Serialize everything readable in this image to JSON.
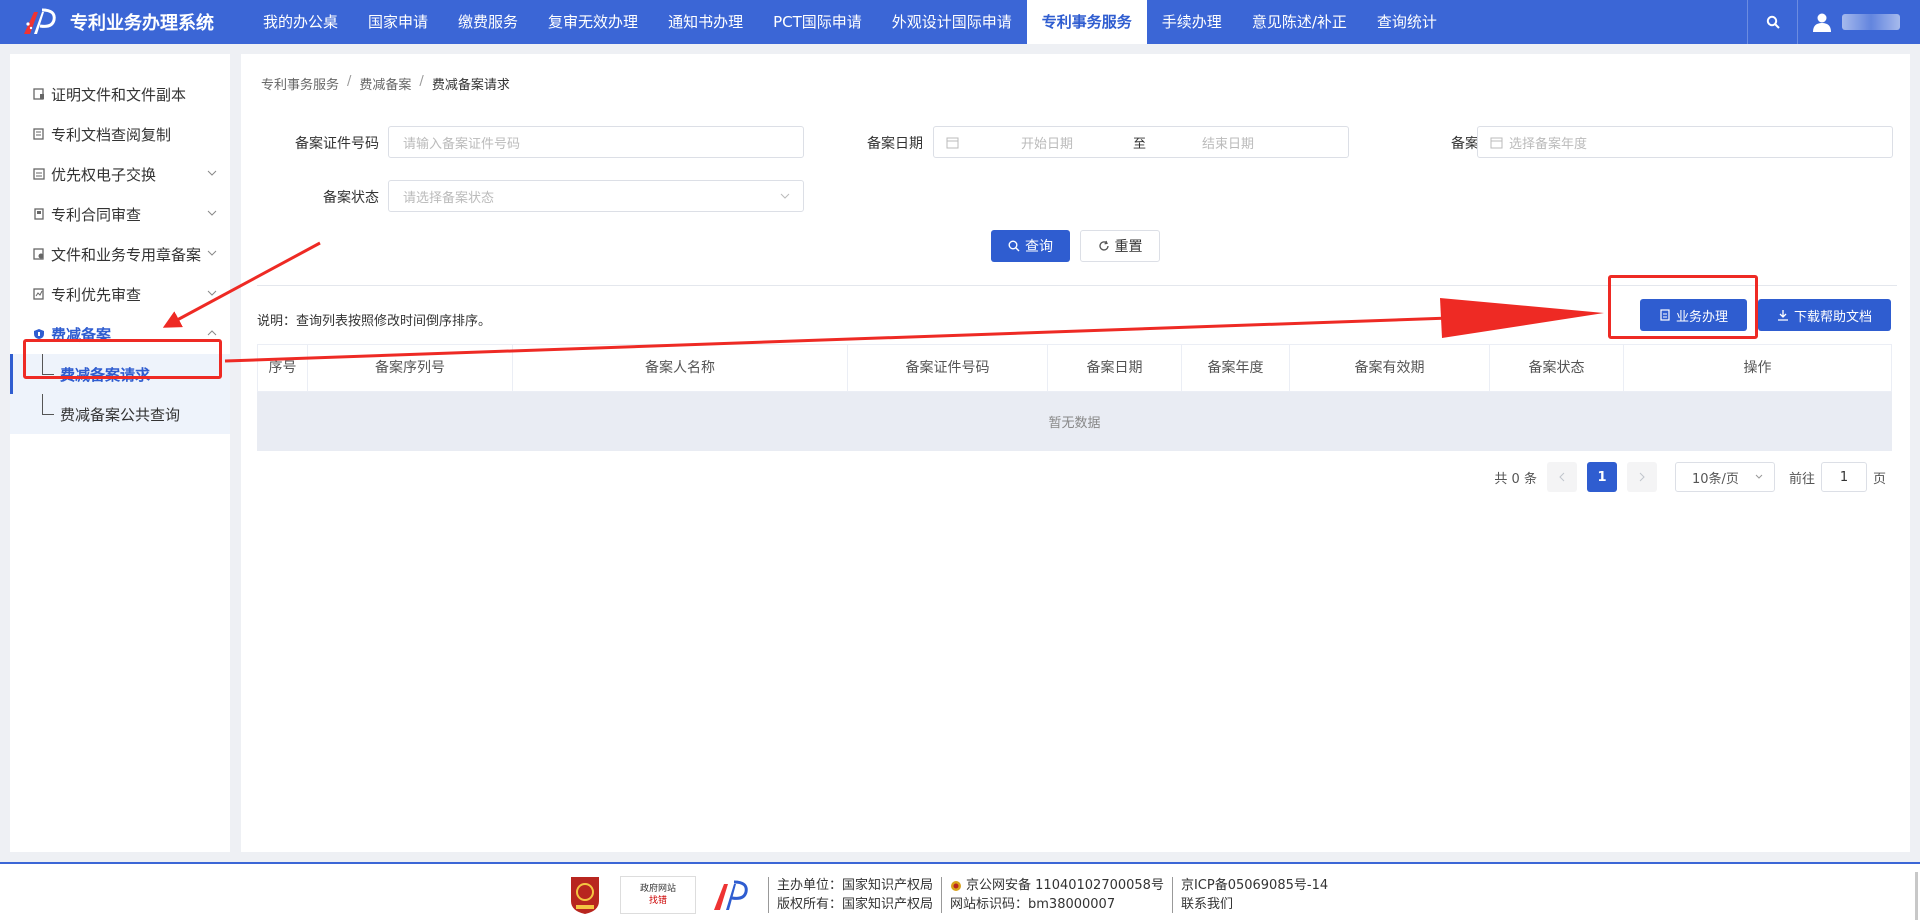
{
  "app": {
    "title": "专利业务办理系统"
  },
  "nav": {
    "items": [
      {
        "label": "我的办公桌"
      },
      {
        "label": "国家申请"
      },
      {
        "label": "缴费服务"
      },
      {
        "label": "复审无效办理"
      },
      {
        "label": "通知书办理"
      },
      {
        "label": "PCT国际申请"
      },
      {
        "label": "外观设计国际申请"
      },
      {
        "label": "专利事务服务",
        "active": true
      },
      {
        "label": "手续办理"
      },
      {
        "label": "意见陈述/补正"
      },
      {
        "label": "查询统计"
      }
    ]
  },
  "sidebar": {
    "items": [
      {
        "label": "证明文件和文件副本",
        "icon": "document-stamp-icon"
      },
      {
        "label": "专利文档查阅复制",
        "icon": "document-copy-icon"
      },
      {
        "label": "优先权电子交换",
        "icon": "exchange-icon",
        "chevron": "down"
      },
      {
        "label": "专利合同审查",
        "icon": "contract-icon",
        "chevron": "down"
      },
      {
        "label": "文件和业务专用章备案",
        "icon": "seal-icon",
        "chevron": "down"
      },
      {
        "label": "专利优先审查",
        "icon": "priority-icon",
        "chevron": "down"
      },
      {
        "label": "费减备案",
        "icon": "shield-icon",
        "chevron": "up",
        "open": true
      }
    ],
    "sub_items": [
      {
        "label": "费减备案请求",
        "active": true
      },
      {
        "label": "费减备案公共查询"
      }
    ]
  },
  "breadcrumb": {
    "items": [
      "专利事务服务",
      "费减备案",
      "费减备案请求"
    ],
    "separator": "/"
  },
  "form": {
    "cert_no": {
      "label": "备案证件号码",
      "placeholder": "请输入备案证件号码"
    },
    "date": {
      "label": "备案日期",
      "start_placeholder": "开始日期",
      "range_sep": "至",
      "end_placeholder": "结束日期"
    },
    "year": {
      "label": "备案年度",
      "placeholder": "选择备案年度"
    },
    "status": {
      "label": "备案状态",
      "placeholder": "请选择备案状态"
    },
    "query_label": "查询",
    "reset_label": "重置"
  },
  "toolbar": {
    "note": "说明：查询列表按照修改时间倒序排序。",
    "business_label": "业务办理",
    "download_label": "下载帮助文档"
  },
  "table": {
    "columns": [
      "序号",
      "备案序列号",
      "备案人名称",
      "备案证件号码",
      "备案日期",
      "备案年度",
      "备案有效期",
      "备案状态",
      "操作"
    ],
    "empty_text": "暂无数据"
  },
  "pagination": {
    "total_text": "共 0 条",
    "current_page": "1",
    "page_size": "10条/页",
    "goto_prefix": "前往",
    "goto_value": "1",
    "goto_suffix": "页"
  },
  "footer": {
    "gov_site_line1": "政府网站",
    "gov_site_line2": "找错",
    "host_line": "主办单位：国家知识产权局",
    "copyright_line": "版权所有：国家知识产权局",
    "police_record": "京公网安备 11040102700058号",
    "site_code": "网站标识码：bm38000007",
    "icp": "京ICP备05069085号-14",
    "contact": "联系我们"
  },
  "colors": {
    "primary": "#3b66d6",
    "button": "#2f5dd0",
    "annotation": "#ee2a24"
  }
}
